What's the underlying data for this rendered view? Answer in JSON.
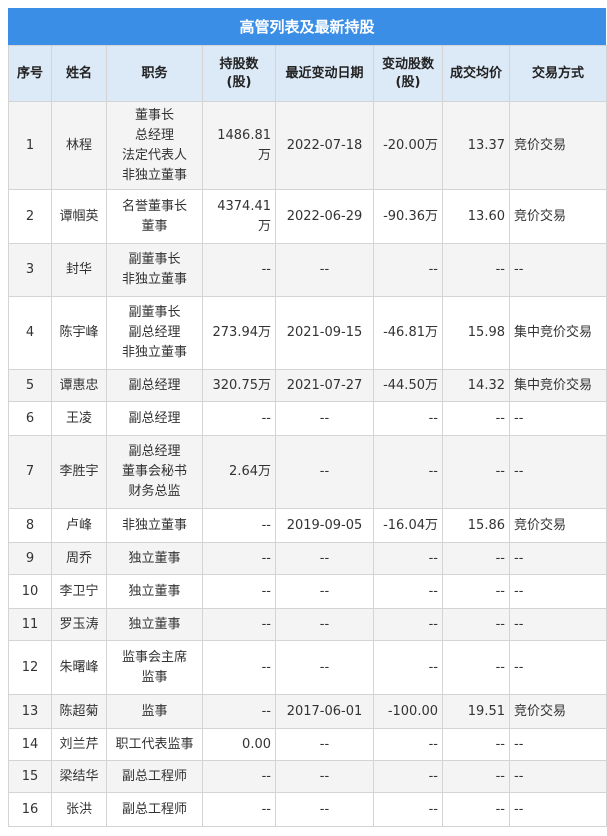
{
  "title": "高管列表及最新持股",
  "headers": [
    "序号",
    "姓名",
    "职务",
    "持股数\n(股)",
    "最近变动日期",
    "变动股数\n(股)",
    "成交均价",
    "交易方式"
  ],
  "rows": [
    {
      "no": "1",
      "name": "林程",
      "positions": [
        "董事长",
        "总经理",
        "法定代表人",
        "非独立董事"
      ],
      "shares": "1486.81万",
      "date": "2022-07-18",
      "change": "-20.00万",
      "price": "13.37",
      "method": "竞价交易"
    },
    {
      "no": "2",
      "name": "谭帼英",
      "positions": [
        "名誉董事长",
        "董事"
      ],
      "shares": "4374.41万",
      "date": "2022-06-29",
      "change": "-90.36万",
      "price": "13.60",
      "method": "竞价交易"
    },
    {
      "no": "3",
      "name": "封华",
      "positions": [
        "副董事长",
        "非独立董事"
      ],
      "shares": "--",
      "date": "--",
      "change": "--",
      "price": "--",
      "method": "--"
    },
    {
      "no": "4",
      "name": "陈宇峰",
      "positions": [
        "副董事长",
        "副总经理",
        "非独立董事"
      ],
      "shares": "273.94万",
      "date": "2021-09-15",
      "change": "-46.81万",
      "price": "15.98",
      "method": "集中竞价交易"
    },
    {
      "no": "5",
      "name": "谭惠忠",
      "positions": [
        "副总经理"
      ],
      "shares": "320.75万",
      "date": "2021-07-27",
      "change": "-44.50万",
      "price": "14.32",
      "method": "集中竞价交易"
    },
    {
      "no": "6",
      "name": "王凌",
      "positions": [
        "副总经理"
      ],
      "shares": "--",
      "date": "--",
      "change": "--",
      "price": "--",
      "method": "--"
    },
    {
      "no": "7",
      "name": "李胜宇",
      "positions": [
        "副总经理",
        "董事会秘书",
        "财务总监"
      ],
      "shares": "2.64万",
      "date": "--",
      "change": "--",
      "price": "--",
      "method": "--"
    },
    {
      "no": "8",
      "name": "卢峰",
      "positions": [
        "非独立董事"
      ],
      "shares": "--",
      "date": "2019-09-05",
      "change": "-16.04万",
      "price": "15.86",
      "method": "竞价交易"
    },
    {
      "no": "9",
      "name": "周乔",
      "positions": [
        "独立董事"
      ],
      "shares": "--",
      "date": "--",
      "change": "--",
      "price": "--",
      "method": "--"
    },
    {
      "no": "10",
      "name": "李卫宁",
      "positions": [
        "独立董事"
      ],
      "shares": "--",
      "date": "--",
      "change": "--",
      "price": "--",
      "method": "--"
    },
    {
      "no": "11",
      "name": "罗玉涛",
      "positions": [
        "独立董事"
      ],
      "shares": "--",
      "date": "--",
      "change": "--",
      "price": "--",
      "method": "--"
    },
    {
      "no": "12",
      "name": "朱曙峰",
      "positions": [
        "监事会主席",
        "监事"
      ],
      "shares": "--",
      "date": "--",
      "change": "--",
      "price": "--",
      "method": "--"
    },
    {
      "no": "13",
      "name": "陈超菊",
      "positions": [
        "监事"
      ],
      "shares": "--",
      "date": "2017-06-01",
      "change": "-100.00",
      "price": "19.51",
      "method": "竞价交易"
    },
    {
      "no": "14",
      "name": "刘兰芹",
      "positions": [
        "职工代表监事"
      ],
      "shares": "0.00",
      "date": "--",
      "change": "--",
      "price": "--",
      "method": "--"
    },
    {
      "no": "15",
      "name": "梁结华",
      "positions": [
        "副总工程师"
      ],
      "shares": "--",
      "date": "--",
      "change": "--",
      "price": "--",
      "method": "--"
    },
    {
      "no": "16",
      "name": "张洪",
      "positions": [
        "副总工程师"
      ],
      "shares": "--",
      "date": "--",
      "change": "--",
      "price": "--",
      "method": "--"
    }
  ],
  "colors": {
    "title_bg": "#3a8ee6",
    "header_bg": "#dce9f7",
    "green": "#27a844"
  }
}
